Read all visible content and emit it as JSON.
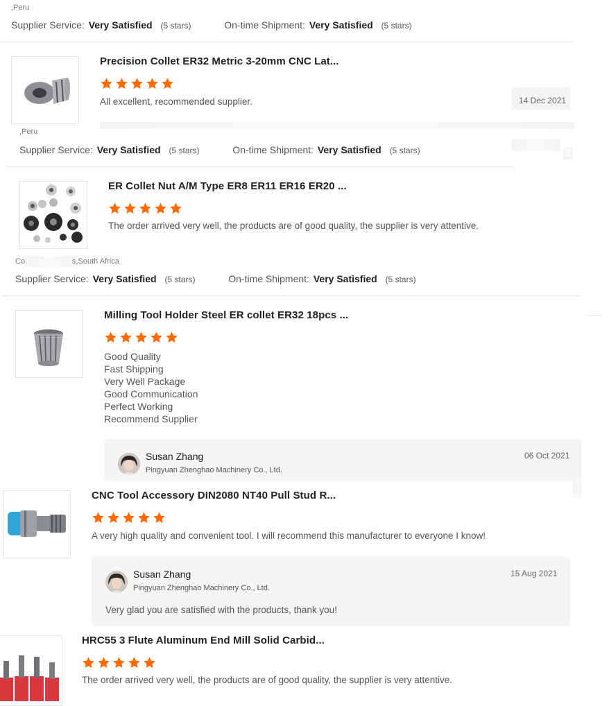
{
  "reviews": [
    {
      "country": ",Peru",
      "supplier_service_label": "Supplier Service:",
      "supplier_service_value": "Very Satisfied",
      "supplier_service_stars": "(5 stars)",
      "shipment_label": "On-time Shipment:",
      "shipment_value": "Very Satisfied",
      "shipment_stars": "(5 stars)"
    },
    {
      "title": "Precision Collet ER32 Metric 3-20mm CNC Lat...",
      "rating": 5,
      "text": "All excellent, recommended supplier.",
      "date": "14 Dec 2021",
      "country": ",Peru",
      "supplier_service_label": "Supplier Service:",
      "supplier_service_value": "Very Satisfied",
      "supplier_service_stars": "(5 stars)",
      "shipment_label": "On-time Shipment:",
      "shipment_value": "Very Satisfied",
      "shipment_stars": "(5 stars)"
    },
    {
      "title": "ER Collet Nut A/M Type ER8 ER11 ER16 ER20 ...",
      "rating": 5,
      "text": "The order arrived very well, the products are of good quality, the supplier is very attentive.",
      "country_prefix": "Co",
      "country": "s,South Africa",
      "supplier_service_label": "Supplier Service:",
      "supplier_service_value": "Very Satisfied",
      "supplier_service_stars": "(5 stars)",
      "shipment_label": "On-time Shipment:",
      "shipment_value": "Very Satisfied",
      "shipment_stars": "(5 stars)"
    },
    {
      "title": "Milling Tool Holder Steel ER collet ER32 18pcs ...",
      "rating": 5,
      "lines": [
        "Good Quality",
        "Fast Shipping",
        "Very Well Package",
        "Good Communication",
        "Perfect Working",
        "Recommend Supplier"
      ],
      "reply": {
        "name": "Susan Zhang",
        "company": "Pingyuan Zhenghao Machinery Co., Ltd.",
        "date": "06 Oct 2021"
      }
    },
    {
      "title": "CNC Tool Accessory DIN2080 NT40 Pull Stud R...",
      "rating": 5,
      "text": "A very high quality and convenient tool.  I will recommend this manufacturer to everyone I know!",
      "reply": {
        "name": "Susan Zhang",
        "company": "Pingyuan Zhenghao Machinery Co., Ltd.",
        "date": "15 Aug 2021",
        "text": "Very glad you are satisfied with the products, thank you!"
      }
    },
    {
      "title": "HRC55 3 Flute Aluminum End Mill Solid Carbid...",
      "rating": 5,
      "text": "The order arrived very well, the products are of good quality, the supplier is very attentive."
    }
  ],
  "colors": {
    "star": "#ff6a00",
    "divider": "#e6e6e6",
    "reply_bg": "#f5f5f5"
  }
}
